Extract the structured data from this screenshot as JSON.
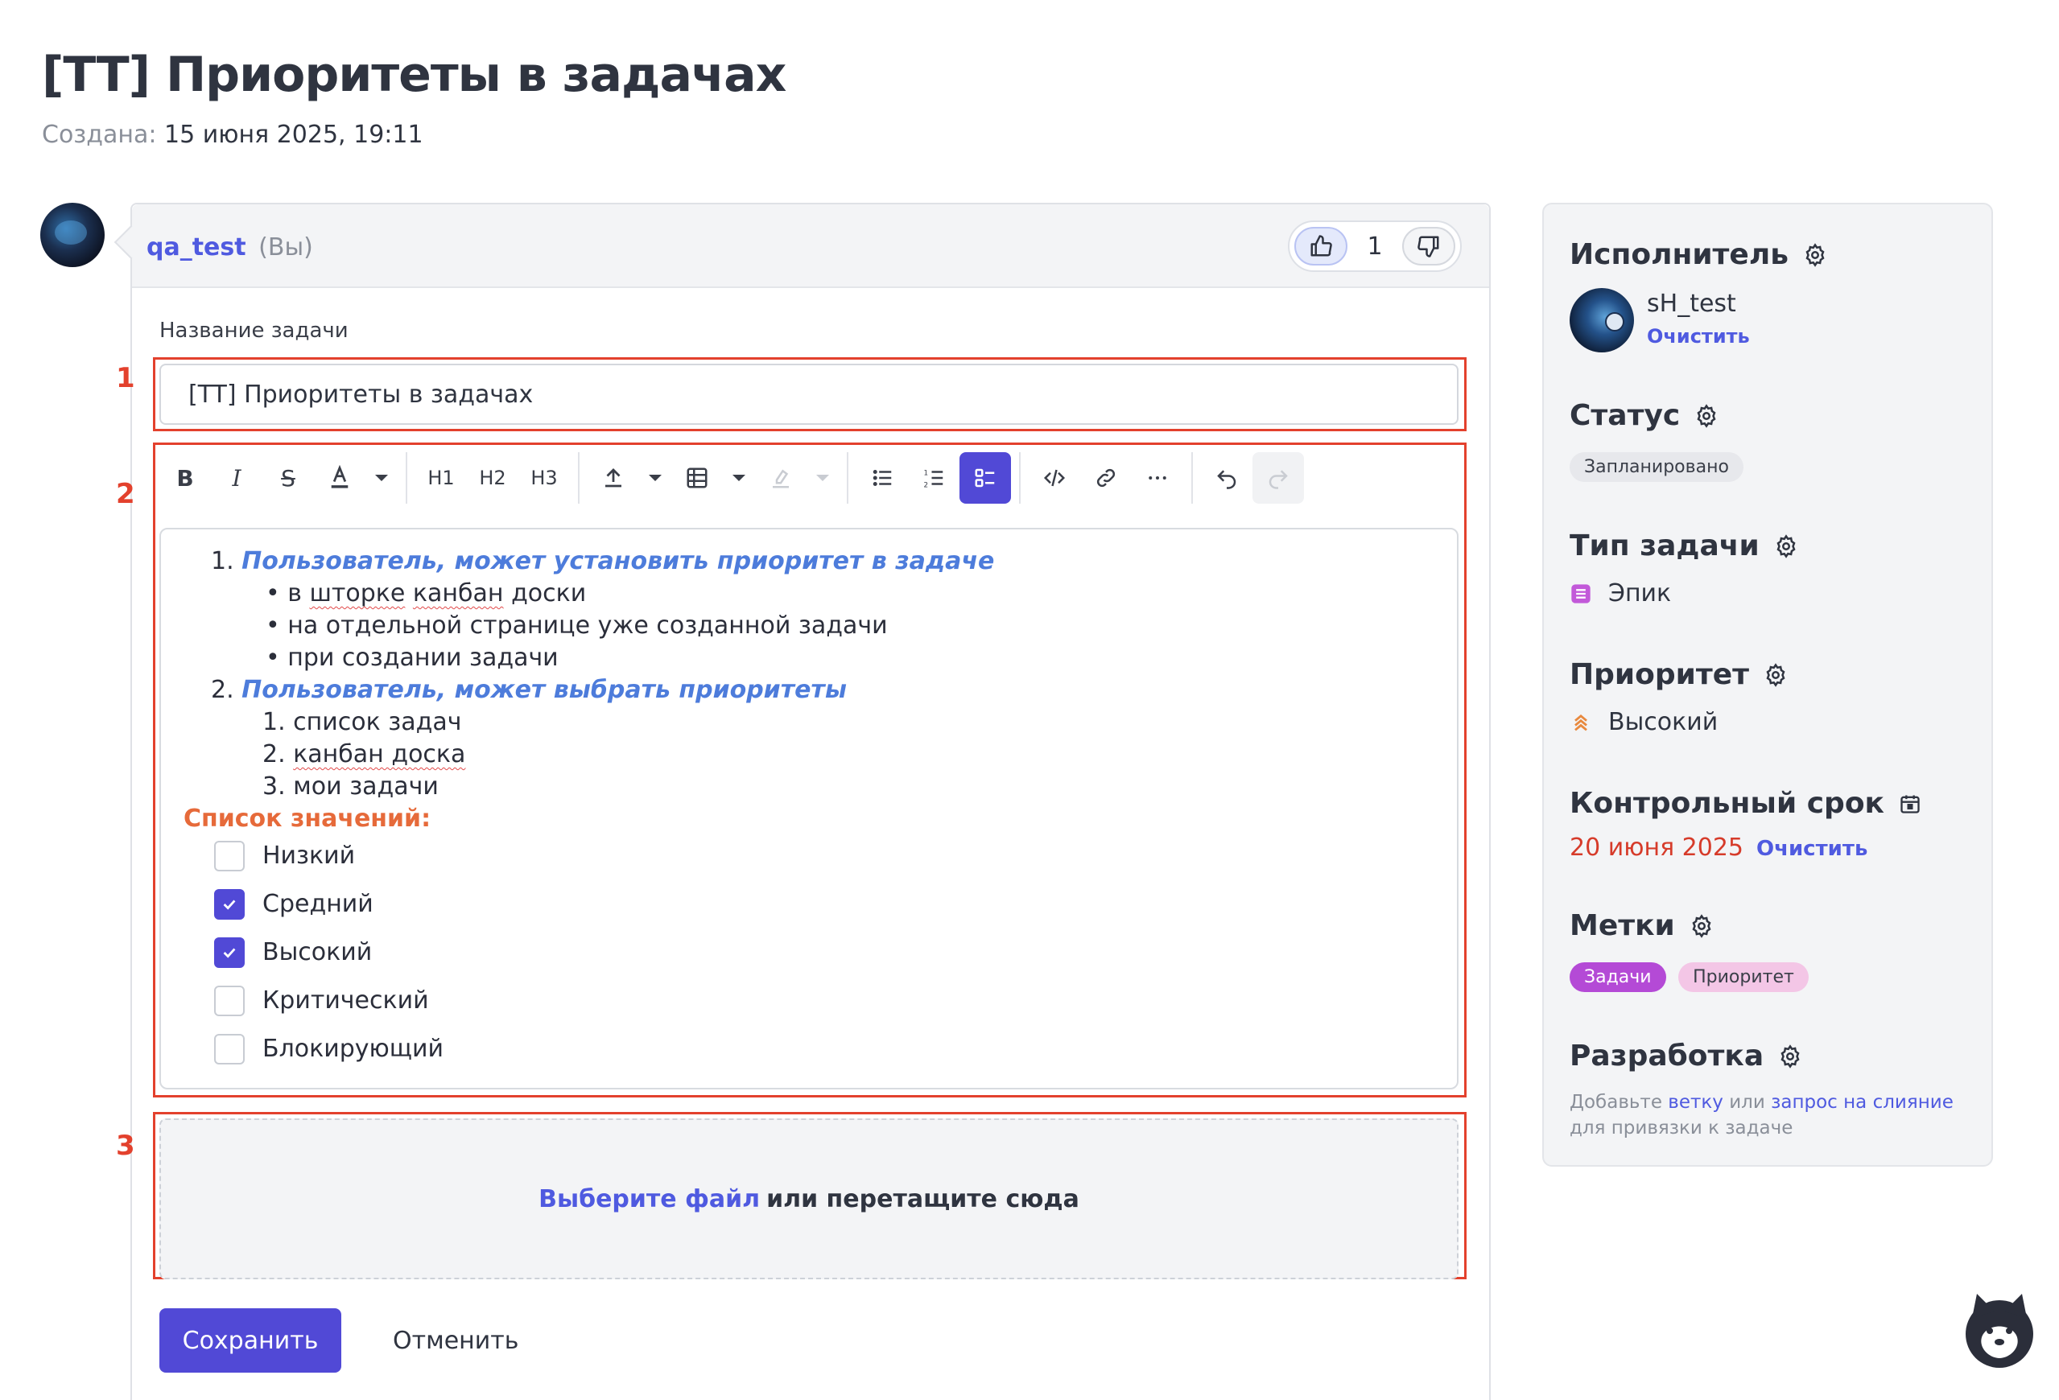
{
  "page": {
    "title": "[TT] Приоритеты в задачах",
    "created_label": "Создана:",
    "created_value": "15 июня 2025, 19:11"
  },
  "comment": {
    "author": "qa_test",
    "you": "(Вы)",
    "like_count": "1"
  },
  "form": {
    "title_label": "Название задачи",
    "title_value": "[TT] Приоритеты в задачах",
    "annotations": [
      "1",
      "2",
      "3"
    ]
  },
  "toolbar": {
    "icons": [
      "bold-icon",
      "italic-icon",
      "strikethrough-icon",
      "text-color-icon",
      "h1-icon",
      "h2-icon",
      "h3-icon",
      "upload-icon",
      "table-icon",
      "highlight-icon",
      "bullet-list-icon",
      "ordered-list-icon",
      "task-list-icon",
      "code-icon",
      "link-icon",
      "more-icon",
      "undo-icon",
      "redo-icon"
    ],
    "h1": "H1",
    "h2": "H2",
    "h3": "H3",
    "bold": "B",
    "italic": "I",
    "strike": "S"
  },
  "editor": {
    "item1_num": "1.",
    "item1": "Пользователь, может установить приоритет в задаче",
    "item1_sub": [
      "в шторке канбан доски",
      "на отдельной странице уже созданной задачи",
      "при создании задачи"
    ],
    "item1_sub_prefix": "в ",
    "item1_sub_spell": "шторке",
    "item1_sub_spell2": "канбан",
    "item1_sub_tail": " доски",
    "item2_num": "2.",
    "item2": "Пользователь, может выбрать приоритеты",
    "item2_sub": [
      {
        "num": "1.",
        "text": "список задач"
      },
      {
        "num": "2.",
        "text": "канбан доска"
      },
      {
        "num": "3.",
        "text": "мои задачи"
      }
    ],
    "values_heading": "Список значений:",
    "checklist": [
      {
        "label": "Низкий",
        "checked": false
      },
      {
        "label": "Средний",
        "checked": true
      },
      {
        "label": "Высокий",
        "checked": true
      },
      {
        "label": "Критический",
        "checked": false
      },
      {
        "label": "Блокирующий",
        "checked": false
      }
    ]
  },
  "dropzone": {
    "link": "Выберите файл",
    "rest": "или перетащите сюда"
  },
  "actions": {
    "save": "Сохранить",
    "cancel": "Отменить"
  },
  "sidebar": {
    "assignee_title": "Исполнитель",
    "assignee_name": "sH_test",
    "assignee_clear": "Очистить",
    "status_title": "Статус",
    "status_value": "Запланировано",
    "type_title": "Тип задачи",
    "type_value": "Эпик",
    "priority_title": "Приоритет",
    "priority_value": "Высокий",
    "deadline_title": "Контрольный срок",
    "deadline_value": "20 июня 2025",
    "deadline_clear": "Очистить",
    "labels_title": "Метки",
    "labels": [
      "Задачи",
      "Приоритет"
    ],
    "dev_title": "Разработка",
    "dev_text_1": "Добавьте",
    "dev_link_branch": "ветку",
    "dev_text_2": "или",
    "dev_link_mr": "запрос на слияние",
    "dev_text_3": "для привязки к задаче"
  },
  "colors": {
    "accent": "#5149d6",
    "link": "#4f5ae0",
    "annotation": "#e3412d",
    "deadline": "#d63b2a",
    "label_primary": "#b44ad6",
    "label_secondary": "#f3c6e6"
  }
}
